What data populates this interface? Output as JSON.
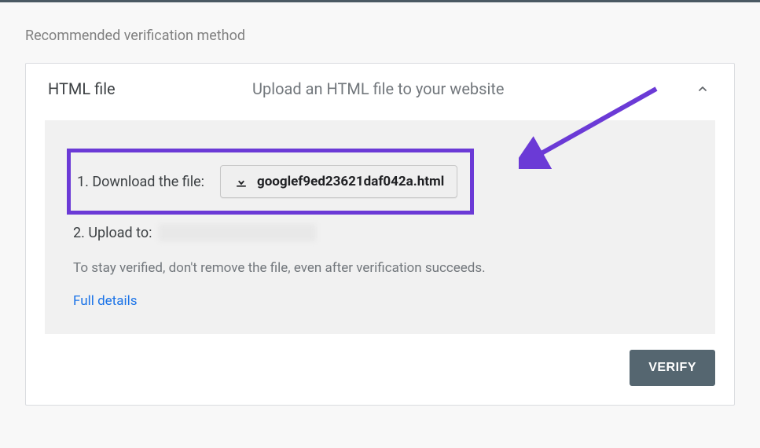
{
  "heading": "Recommended verification method",
  "card": {
    "title": "HTML file",
    "subtitle": "Upload an HTML file to your website",
    "step1_label": "1. Download the file:",
    "download_filename": "googlef9ed23621daf042a.html",
    "step2_label": "2. Upload to:",
    "note": "To stay verified, don't remove the file, even after verification succeeds.",
    "details_link": "Full details",
    "verify_button": "VERIFY"
  },
  "annotation": {
    "arrow_color": "#6b3ad6"
  }
}
